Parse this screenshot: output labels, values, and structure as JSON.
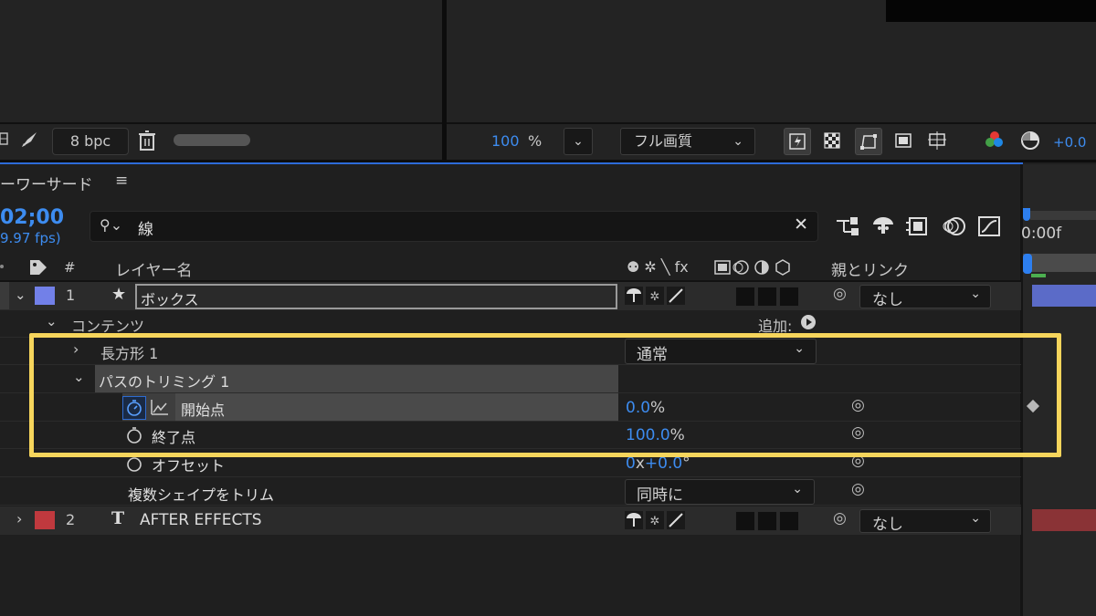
{
  "top": {
    "bpc_label": "8 bpc",
    "zoom_value": "100",
    "zoom_unit": "%",
    "quality_label": "フル画質",
    "exposure_value": "+0.0"
  },
  "timeline": {
    "panel_title": "ーワーサード",
    "menu_icon": "≡",
    "timecode": "02;00",
    "fps": "9.97 fps)",
    "search_value": "線",
    "ruler_label": "0:00f",
    "columns": {
      "hash": "#",
      "layer_name": "レイヤー名",
      "parent_link": "親とリンク",
      "switches": "⚉ ✲ ╲ fx"
    },
    "layers": [
      {
        "index": "1",
        "name": "ボックス",
        "parent": "なし",
        "label_color": "#7280e8"
      },
      {
        "index": "2",
        "name": "AFTER EFFECTS",
        "parent": "なし",
        "label_color": "#c0393e"
      }
    ],
    "contents_label": "コンテンツ",
    "add_label": "追加:",
    "rect_label": "長方形 1",
    "blend_mode": "通常",
    "trim_label": "パスのトリミング 1",
    "props": [
      {
        "name": "開始点",
        "value_num": "0.0",
        "value_unit": "%"
      },
      {
        "name": "終了点",
        "value_num": "100.0",
        "value_unit": "%"
      },
      {
        "name": "オフセット",
        "value_num": "0",
        "value_mid": "x",
        "value_num2": "+0.0",
        "value_unit": "°"
      }
    ],
    "multi_shape_label": "複数シェイプをトリム",
    "multi_shape_value": "同時に"
  },
  "colors": {
    "highlight": "#f6d55c",
    "accent_blue": "#3d8cf0"
  }
}
